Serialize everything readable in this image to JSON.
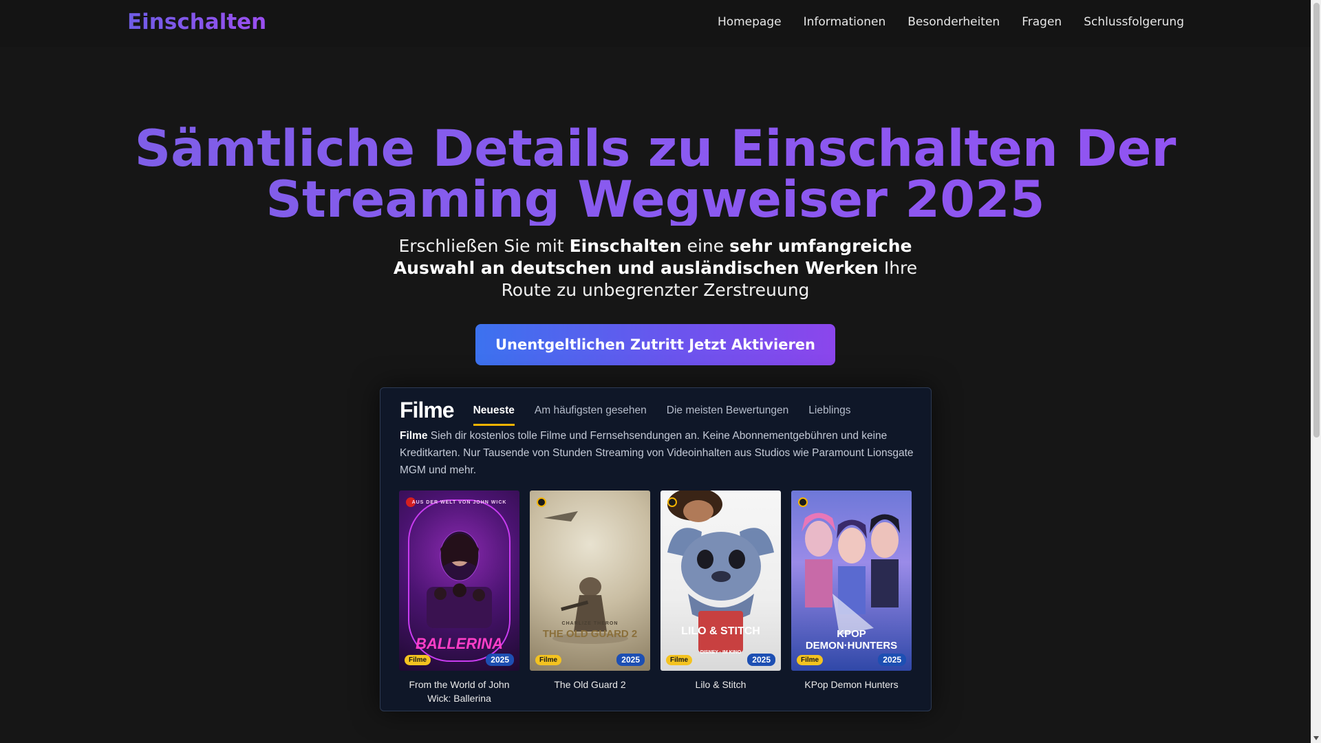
{
  "header": {
    "brand": "Einschalten",
    "nav": [
      "Homepage",
      "Informationen",
      "Besonderheiten",
      "Fragen",
      "Schlussfolgerung"
    ]
  },
  "hero": {
    "title_line1": "Sämtliche Details zu Einschalten Der",
    "title_line2": "Streaming Wegweiser 2025",
    "sub_1": "Erschließen Sie mit ",
    "sub_2": "Einschalten",
    "sub_3": " eine ",
    "sub_4": "sehr umfangreiche Auswahl an deutschen und ausländischen Werken",
    "sub_5": " Ihre Route zu unbegrenzter Zerstreuung",
    "cta_label": "Unentgeltlichen Zutritt Jetzt Aktivieren"
  },
  "panel": {
    "title": "Filme",
    "tabs": [
      "Neueste",
      "Am häufigsten gesehen",
      "Die meisten Bewertungen",
      "Lieblings"
    ],
    "active_tab": "Neueste",
    "desc_bold": "Filme",
    "desc_text": " Sieh dir kostenlos tolle Filme und Fernsehsendungen an. Keine Abonnementgebühren und keine Kreditkarten. Nur Tausende von Stunden Streaming von Videoinhalten aus Studios wie Paramount Lionsgate MGM und mehr.",
    "movies": [
      {
        "title": "From the World of John Wick: Ballerina",
        "tag": "Filme",
        "year": "2025",
        "poster_text": "BALLERINA",
        "poster_top": "AUS DER WELT VON JOHN WICK"
      },
      {
        "title": "The Old Guard 2",
        "tag": "Filme",
        "year": "2025",
        "poster_text": "THE OLD GUARD 2",
        "poster_top": "CHARLIZE THERON"
      },
      {
        "title": "Lilo & Stitch",
        "tag": "Filme",
        "year": "2025",
        "poster_text": "LILO & STITCH",
        "poster_top": "DISNEY · IM KINO"
      },
      {
        "title": "KPop Demon Hunters",
        "tag": "Filme",
        "year": "2025",
        "poster_text": "KPOP DEMON·HUNTERS",
        "poster_top": ""
      }
    ]
  },
  "colors": {
    "accent": "#8b5cf6",
    "cta_start": "#3c72ef",
    "cta_end": "#8b46ec",
    "tab_underline": "#f4b400",
    "badge_tag": "#f4c320",
    "badge_year": "#1d4fb3"
  }
}
